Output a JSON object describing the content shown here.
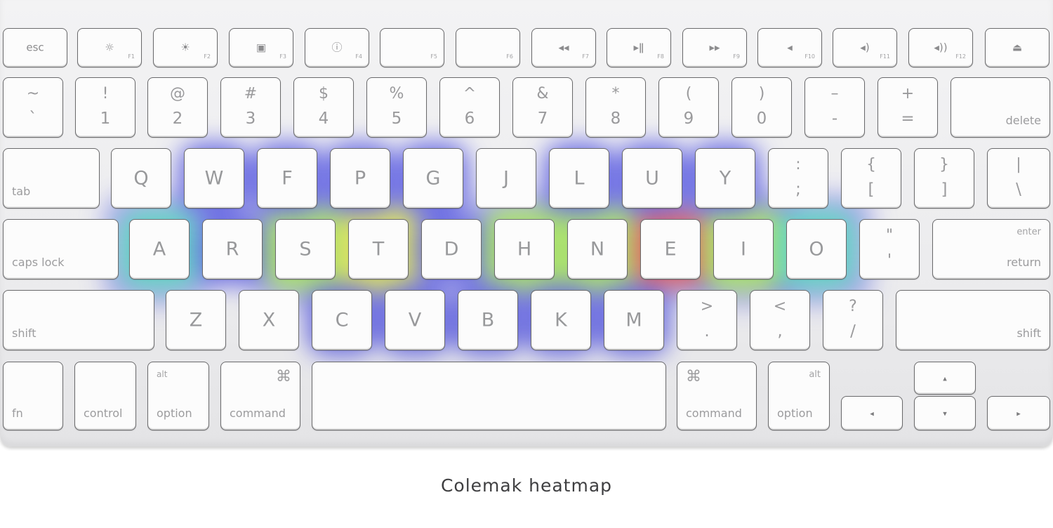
{
  "caption": "Colemak heatmap",
  "colors": {
    "cold": "#5a5cf0",
    "cool": "#4fe0c8",
    "mid": "#a8f05a",
    "warm": "#e8f04a",
    "hot": "#f05050"
  },
  "function_row": [
    {
      "name": "esc-key",
      "label": "esc",
      "flabel": ""
    },
    {
      "name": "brightness-down-key",
      "label": "☼",
      "flabel": "F1"
    },
    {
      "name": "brightness-up-key",
      "label": "☀",
      "flabel": "F2"
    },
    {
      "name": "mission-control-key",
      "label": "▣",
      "flabel": "F3"
    },
    {
      "name": "dashboard-key",
      "label": "ⓘ",
      "flabel": "F4"
    },
    {
      "name": "f5-key",
      "label": "",
      "flabel": "F5"
    },
    {
      "name": "f6-key",
      "label": "",
      "flabel": "F6"
    },
    {
      "name": "rewind-key",
      "label": "◂◂",
      "flabel": "F7"
    },
    {
      "name": "play-pause-key",
      "label": "▸ǁ",
      "flabel": "F8"
    },
    {
      "name": "fast-forward-key",
      "label": "▸▸",
      "flabel": "F9"
    },
    {
      "name": "mute-key",
      "label": "◂",
      "flabel": "F10"
    },
    {
      "name": "volume-down-key",
      "label": "◂)",
      "flabel": "F11"
    },
    {
      "name": "volume-up-key",
      "label": "◂))",
      "flabel": "F12"
    },
    {
      "name": "eject-key",
      "label": "⏏",
      "flabel": ""
    }
  ],
  "number_row": [
    {
      "top": "~",
      "bottom": "`"
    },
    {
      "top": "!",
      "bottom": "1"
    },
    {
      "top": "@",
      "bottom": "2"
    },
    {
      "top": "#",
      "bottom": "3"
    },
    {
      "top": "$",
      "bottom": "4"
    },
    {
      "top": "%",
      "bottom": "5"
    },
    {
      "top": "^",
      "bottom": "6"
    },
    {
      "top": "&",
      "bottom": "7"
    },
    {
      "top": "*",
      "bottom": "8"
    },
    {
      "top": "(",
      "bottom": "9"
    },
    {
      "top": ")",
      "bottom": "0"
    },
    {
      "top": "–",
      "bottom": "-"
    },
    {
      "top": "+",
      "bottom": "="
    }
  ],
  "delete_label": "delete",
  "tab_label": "tab",
  "top_row": [
    "Q",
    "W",
    "F",
    "P",
    "G",
    "J",
    "L",
    "U",
    "Y"
  ],
  "top_row_symbols": [
    {
      "top": ":",
      "bottom": ";"
    },
    {
      "top": "{",
      "bottom": "["
    },
    {
      "top": "}",
      "bottom": "]"
    },
    {
      "top": "|",
      "bottom": "\\"
    }
  ],
  "caps_label": "caps lock",
  "home_row": [
    "A",
    "R",
    "S",
    "T",
    "D",
    "H",
    "N",
    "E",
    "I",
    "O"
  ],
  "quote_key": {
    "top": "\"",
    "bottom": "'"
  },
  "enter_label": "enter",
  "return_label": "return",
  "shift_left_label": "shift",
  "bottom_row": [
    "Z",
    "X",
    "C",
    "V",
    "B",
    "K",
    "M"
  ],
  "bottom_row_symbols": [
    {
      "top": ">",
      "bottom": "."
    },
    {
      "top": "<",
      "bottom": ","
    },
    {
      "top": "?",
      "bottom": "/"
    }
  ],
  "shift_right_label": "shift",
  "modifiers": {
    "fn": "fn",
    "control": "control",
    "alt": "alt",
    "option": "option",
    "cmd_symbol": "⌘",
    "command": "command"
  },
  "arrows": {
    "left": "◂",
    "up": "▴",
    "down": "▾",
    "right": "▸"
  },
  "heat_levels": {
    "A": "cool",
    "R": "cold",
    "S": "mid",
    "T": "warm",
    "D": "cold",
    "H": "mid",
    "N": "mid",
    "E": "hot",
    "I": "mid",
    "O": "cool",
    "W": "cold",
    "F": "cold",
    "P": "cold",
    "G": "cold",
    "L": "cold",
    "U": "cold",
    "Y": "cold",
    "C": "cold",
    "V": "cold",
    "B": "cold",
    "K": "cold",
    "M": "cold"
  }
}
